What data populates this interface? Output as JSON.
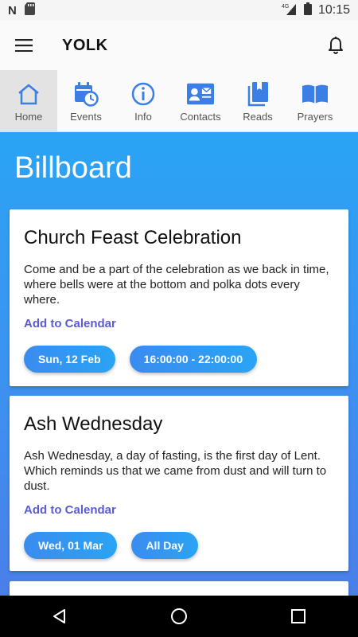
{
  "status_bar": {
    "left_letter": "N",
    "network": "4G",
    "time": "10:15"
  },
  "app_bar": {
    "title": "YOLK"
  },
  "tabs": [
    {
      "label": "Home",
      "icon": "home-icon"
    },
    {
      "label": "Events",
      "icon": "calendar-clock-icon"
    },
    {
      "label": "Info",
      "icon": "info-icon"
    },
    {
      "label": "Contacts",
      "icon": "contact-card-icon"
    },
    {
      "label": "Reads",
      "icon": "books-icon"
    },
    {
      "label": "Prayers",
      "icon": "open-book-icon"
    }
  ],
  "colors": {
    "accent": "#3f8ff0",
    "link": "#5b5bd6",
    "icon_blue": "#3a7ee6"
  },
  "main": {
    "title": "Billboard",
    "cards": [
      {
        "title": "Church Feast Celebration",
        "description": "Come and be a part of the celebration as we back in time, where bells were at the bottom and polka dots every where.",
        "add_to_calendar": "Add to Calendar",
        "date": "Sun, 12 Feb",
        "time": "16:00:00 - 22:00:00"
      },
      {
        "title": "Ash Wednesday",
        "description": "Ash Wednesday, a day of fasting, is the first day of Lent. Which reminds us that we came from dust and will turn to dust.",
        "add_to_calendar": "Add to Calendar",
        "date": "Wed, 01 Mar",
        "time": "All Day"
      }
    ]
  }
}
